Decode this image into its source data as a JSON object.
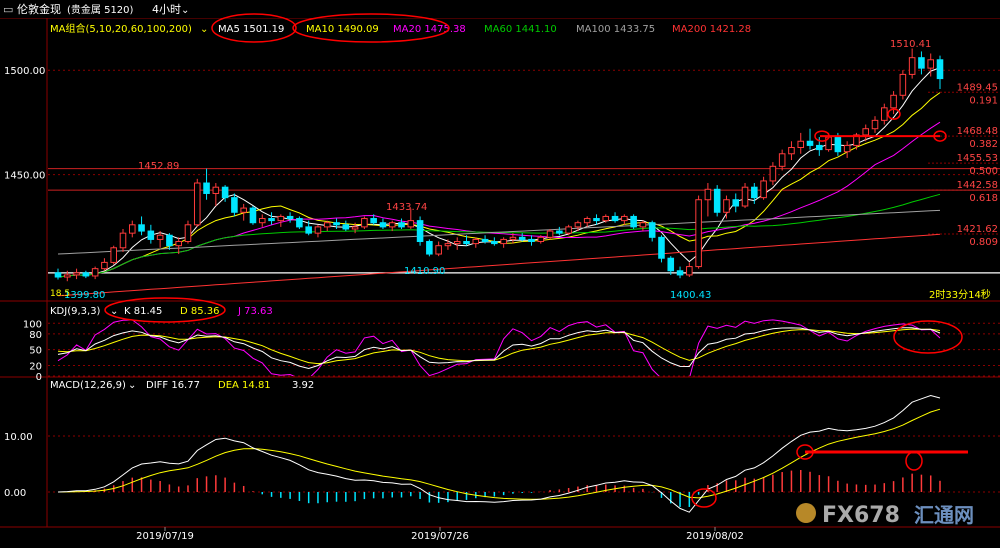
{
  "header": {
    "symbol_icon": "window-restore-icon",
    "title": "伦敦金现",
    "market": "(贵金属 5120)",
    "period": "4小时",
    "period_icon": "chevron-down-icon"
  },
  "indicators": {
    "ma_group": "MA组合(5,10,20,60,100,200)",
    "ma5": "MA5 1501.19",
    "ma10": "MA10 1490.09",
    "ma20": "MA20 1475.38",
    "ma60": "MA60 1441.10",
    "ma100": "MA100 1433.75",
    "ma200": "MA200 1421.28",
    "kdj_title": "KDJ(9,3,3)",
    "k": "K 81.45",
    "d": "D 85.36",
    "j": "J 73.63",
    "macd_title": "MACD(12,26,9)",
    "diff": "DIFF 16.77",
    "dea": "DEA 14.81",
    "macd": "3.92"
  },
  "price_labels": {
    "high": "1510.41",
    "label_1452": "1452.89",
    "label_1433": "1433.74",
    "label_1410": "1410.90",
    "label_1400": "1400.43",
    "label_1399": "1399.80",
    "label_corner": "18.5"
  },
  "fib_levels": [
    {
      "price": "1489.45",
      "ratio": "0.191"
    },
    {
      "price": "1468.48",
      "ratio": "0.382"
    },
    {
      "price": "1455.53",
      "ratio": "0.500"
    },
    {
      "price": "1442.58",
      "ratio": "0.618"
    },
    {
      "price": "1421.62",
      "ratio": "0.809"
    }
  ],
  "countdown": "2时33分14秒",
  "watermark": {
    "brand": "FX678",
    "cn": "汇通网"
  },
  "colors": {
    "bg": "#000000",
    "grid": "#8b0000",
    "up": "#ff3b3b",
    "down": "#00e5ff",
    "ma5": "#ffffff",
    "ma10": "#ffff00",
    "ma20": "#ff00ff",
    "ma60": "#00cc00",
    "ma100": "#a0a0a0",
    "ma200": "#ff3333",
    "annotation": "#ff0000"
  },
  "chart_data": [
    {
      "type": "candlestick",
      "title": "伦敦金现 4小时",
      "ylabel": "",
      "ylim": [
        1390,
        1525
      ],
      "yticks": [
        1450.0,
        1500.0
      ],
      "ytick_labels": [
        "1450.00",
        "1500.00"
      ],
      "x_dates": [
        "2019/07/19",
        "2019/07/26",
        "2019/08/02"
      ],
      "grid": true,
      "ohlc": [
        [
          1403,
          1405,
          1399.8,
          1401
        ],
        [
          1401,
          1404,
          1399,
          1402
        ],
        [
          1402,
          1405,
          1400,
          1403
        ],
        [
          1403,
          1404,
          1400.5,
          1401.5
        ],
        [
          1401.5,
          1406,
          1400,
          1405
        ],
        [
          1405,
          1410,
          1404,
          1408
        ],
        [
          1408,
          1416,
          1407,
          1415
        ],
        [
          1415,
          1424,
          1413,
          1422
        ],
        [
          1422,
          1428,
          1420,
          1426
        ],
        [
          1426,
          1430,
          1421,
          1423
        ],
        [
          1423,
          1426,
          1417,
          1419
        ],
        [
          1419,
          1423,
          1415,
          1421
        ],
        [
          1421,
          1422,
          1414,
          1416
        ],
        [
          1416,
          1420,
          1412,
          1418
        ],
        [
          1418,
          1428,
          1417,
          1426
        ],
        [
          1426,
          1448,
          1425,
          1446
        ],
        [
          1446,
          1452.89,
          1438,
          1441
        ],
        [
          1441,
          1446,
          1435,
          1444
        ],
        [
          1444,
          1445,
          1437,
          1439
        ],
        [
          1439,
          1441,
          1430,
          1432
        ],
        [
          1432,
          1436,
          1428,
          1434
        ],
        [
          1434,
          1435,
          1426,
          1427
        ],
        [
          1427,
          1431,
          1425,
          1429
        ],
        [
          1429,
          1432,
          1426,
          1428
        ],
        [
          1428,
          1431,
          1425,
          1430
        ],
        [
          1430,
          1432,
          1427,
          1429
        ],
        [
          1429,
          1430,
          1424,
          1425
        ],
        [
          1425,
          1428,
          1421,
          1422
        ],
        [
          1422,
          1426,
          1420,
          1425
        ],
        [
          1425,
          1428,
          1423,
          1427
        ],
        [
          1427,
          1429,
          1424,
          1426
        ],
        [
          1426,
          1428,
          1423,
          1424
        ],
        [
          1424,
          1427,
          1422,
          1425
        ],
        [
          1425,
          1430,
          1424,
          1429
        ],
        [
          1429,
          1431,
          1426,
          1427
        ],
        [
          1427,
          1429,
          1424,
          1425
        ],
        [
          1425,
          1428,
          1423,
          1427
        ],
        [
          1427,
          1429,
          1424,
          1425
        ],
        [
          1425,
          1433.74,
          1424,
          1428
        ],
        [
          1428,
          1430,
          1416,
          1418
        ],
        [
          1418,
          1419,
          1410.9,
          1412
        ],
        [
          1412,
          1418,
          1411,
          1416
        ],
        [
          1416,
          1419,
          1414,
          1417
        ],
        [
          1417,
          1420,
          1414,
          1418
        ],
        [
          1418,
          1421,
          1416,
          1417
        ],
        [
          1417,
          1420,
          1415,
          1419
        ],
        [
          1419,
          1421,
          1417,
          1418
        ],
        [
          1418,
          1420,
          1416,
          1417
        ],
        [
          1417,
          1420,
          1415,
          1419
        ],
        [
          1419,
          1422,
          1417,
          1420
        ],
        [
          1420,
          1422,
          1418,
          1419
        ],
        [
          1419,
          1421,
          1416,
          1418
        ],
        [
          1418,
          1421,
          1417,
          1420
        ],
        [
          1420,
          1424,
          1419,
          1423
        ],
        [
          1423,
          1425,
          1421,
          1422
        ],
        [
          1422,
          1426,
          1421,
          1425
        ],
        [
          1425,
          1428,
          1423,
          1427
        ],
        [
          1427,
          1430,
          1425,
          1429
        ],
        [
          1429,
          1431,
          1426,
          1428
        ],
        [
          1428,
          1431,
          1427,
          1430
        ],
        [
          1430,
          1432,
          1427,
          1428
        ],
        [
          1428,
          1431,
          1426,
          1430
        ],
        [
          1430,
          1431,
          1424,
          1425
        ],
        [
          1425,
          1428,
          1423,
          1427
        ],
        [
          1427,
          1428,
          1418,
          1420
        ],
        [
          1420,
          1421,
          1408,
          1410
        ],
        [
          1410,
          1411,
          1402,
          1404
        ],
        [
          1404,
          1406,
          1400.43,
          1402
        ],
        [
          1402,
          1408,
          1401,
          1406
        ],
        [
          1406,
          1440,
          1405,
          1438
        ],
        [
          1438,
          1446,
          1430,
          1443
        ],
        [
          1443,
          1445,
          1430,
          1432
        ],
        [
          1432,
          1440,
          1429,
          1438
        ],
        [
          1438,
          1441,
          1432,
          1435
        ],
        [
          1435,
          1446,
          1434,
          1444
        ],
        [
          1444,
          1446,
          1436,
          1439
        ],
        [
          1439,
          1449,
          1438,
          1447
        ],
        [
          1447,
          1456,
          1445,
          1454
        ],
        [
          1454,
          1462,
          1452,
          1460
        ],
        [
          1460,
          1466,
          1457,
          1463
        ],
        [
          1463,
          1470,
          1460,
          1466
        ],
        [
          1466,
          1472,
          1462,
          1464
        ],
        [
          1464,
          1468,
          1459,
          1462
        ],
        [
          1462,
          1470,
          1461,
          1468
        ],
        [
          1468,
          1470,
          1459,
          1461
        ],
        [
          1461,
          1466,
          1458,
          1464
        ],
        [
          1464,
          1470,
          1462,
          1469
        ],
        [
          1469,
          1474,
          1466,
          1472
        ],
        [
          1472,
          1478,
          1470,
          1476
        ],
        [
          1476,
          1484,
          1474,
          1482
        ],
        [
          1482,
          1490,
          1479,
          1488
        ],
        [
          1488,
          1500,
          1486,
          1498
        ],
        [
          1498,
          1510.41,
          1496,
          1506
        ],
        [
          1506,
          1509,
          1498,
          1501
        ],
        [
          1501,
          1508,
          1497,
          1505
        ],
        [
          1505,
          1507,
          1491,
          1496
        ]
      ],
      "kdj": {
        "ylim": [
          0,
          110
        ],
        "yticks": [
          0,
          20,
          50,
          80,
          100
        ],
        "k_last": 81.45,
        "d_last": 85.36,
        "j_last": 73.63
      },
      "macd": {
        "yticks": [
          0.0,
          10.0
        ],
        "ytick_labels": [
          "0.00",
          "10.00"
        ],
        "diff_last": 16.77,
        "dea_last": 14.81,
        "macd_last": 3.92
      }
    }
  ]
}
